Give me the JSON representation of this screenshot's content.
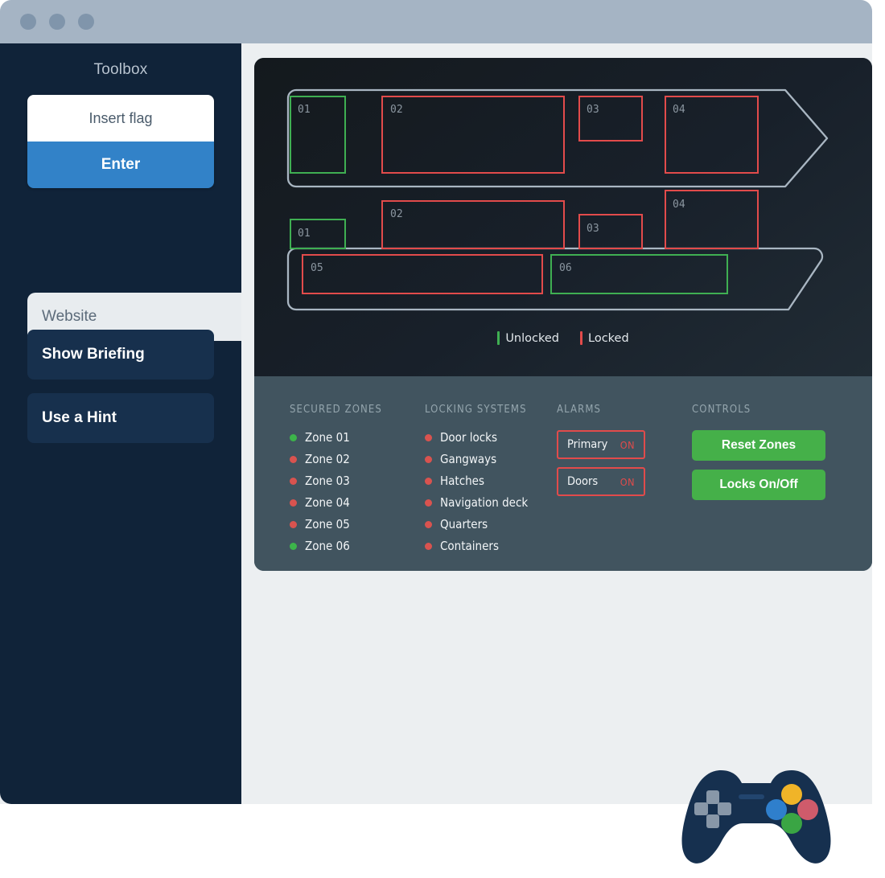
{
  "window": {
    "traffic_lights": [
      "close",
      "minimize",
      "maximize"
    ]
  },
  "sidebar": {
    "title": "Toolbox",
    "flag_input": {
      "value": "",
      "placeholder": "Insert flag"
    },
    "enter_button": "Enter",
    "tab": "Website",
    "buttons": [
      {
        "label": "Show Briefing"
      },
      {
        "label": "Use a Hint"
      }
    ]
  },
  "diagram": {
    "legend": [
      {
        "label": "Unlocked",
        "color": "#3faf52"
      },
      {
        "label": "Locked",
        "color": "#e24b4b"
      }
    ],
    "ships": [
      {
        "name": "upper-deck",
        "zones": [
          {
            "id": "01",
            "state": "unlocked"
          },
          {
            "id": "02",
            "state": "locked"
          },
          {
            "id": "03",
            "state": "locked"
          },
          {
            "id": "04",
            "state": "locked"
          }
        ]
      },
      {
        "name": "lower-deck",
        "zones": [
          {
            "id": "01",
            "state": "unlocked"
          },
          {
            "id": "02",
            "state": "locked"
          },
          {
            "id": "03",
            "state": "locked"
          },
          {
            "id": "04",
            "state": "locked"
          },
          {
            "id": "05",
            "state": "locked"
          },
          {
            "id": "06",
            "state": "unlocked"
          }
        ]
      }
    ]
  },
  "panel": {
    "zones": {
      "heading": "SECURED ZONES",
      "items": [
        {
          "label": "Zone 01",
          "state": "unlocked"
        },
        {
          "label": "Zone 02",
          "state": "locked"
        },
        {
          "label": "Zone 03",
          "state": "locked"
        },
        {
          "label": "Zone 04",
          "state": "locked"
        },
        {
          "label": "Zone 05",
          "state": "locked"
        },
        {
          "label": "Zone 06",
          "state": "unlocked"
        }
      ]
    },
    "locking": {
      "heading": "LOCKING SYSTEMS",
      "items": [
        {
          "label": "Door locks",
          "state": "locked"
        },
        {
          "label": "Gangways",
          "state": "locked"
        },
        {
          "label": "Hatches",
          "state": "locked"
        },
        {
          "label": "Navigation deck",
          "state": "locked"
        },
        {
          "label": "Quarters",
          "state": "locked"
        },
        {
          "label": "Containers",
          "state": "locked"
        }
      ]
    },
    "alarms": {
      "heading": "ALARMS",
      "items": [
        {
          "name": "Primary",
          "state": "ON"
        },
        {
          "name": "Doors",
          "state": "ON"
        }
      ]
    },
    "controls": {
      "heading": "CONTROLS",
      "buttons": [
        {
          "label": "Reset Zones"
        },
        {
          "label": "Locks On/Off"
        }
      ]
    }
  },
  "colors": {
    "unlocked": "#3faf52",
    "locked": "#e24b4b",
    "dot_unlocked": "#3cb44a",
    "dot_locked": "#d9534f",
    "accent_blue": "#3282c8",
    "green_button": "#45b049",
    "sidebar_bg": "#102339",
    "titlebar_bg": "#a5b4c4",
    "panel_bg": "#41545f",
    "hull_stroke": "#a9b6c2"
  },
  "gamepad": {
    "body_color": "#16304f",
    "dpad_color": "#8897a8",
    "buttons": [
      {
        "name": "yellow",
        "color": "#f0b428"
      },
      {
        "name": "red",
        "color": "#cf5b6b"
      },
      {
        "name": "green",
        "color": "#3aa544"
      },
      {
        "name": "blue",
        "color": "#2f7fcc"
      }
    ]
  }
}
